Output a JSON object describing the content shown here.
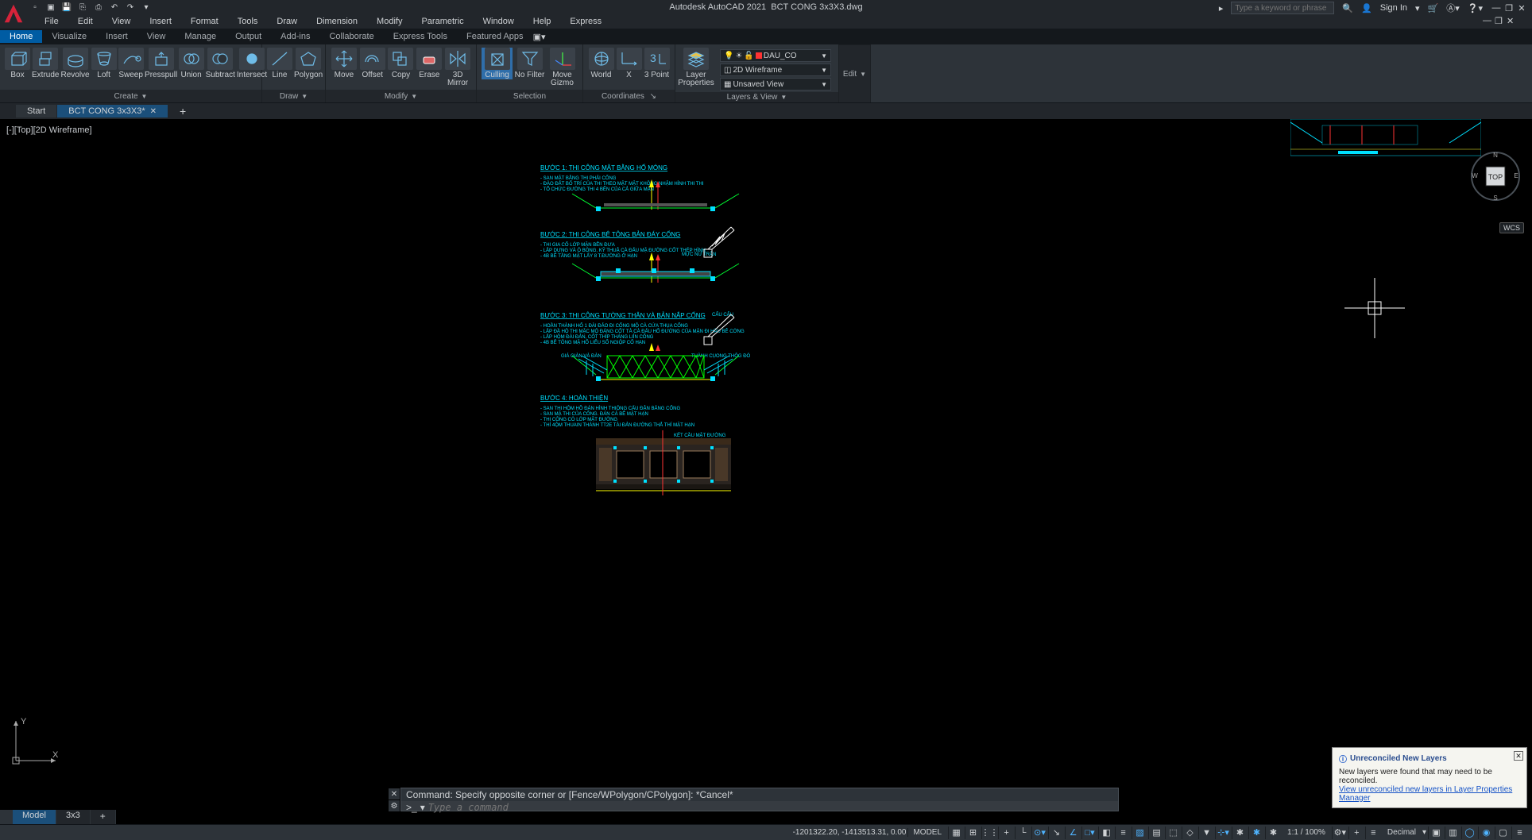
{
  "title": {
    "app": "Autodesk AutoCAD 2021",
    "file": "BCT CONG 3x3X3.dwg"
  },
  "search_placeholder": "Type a keyword or phrase",
  "sign_in": "Sign In",
  "menu": [
    "File",
    "Edit",
    "View",
    "Insert",
    "Format",
    "Tools",
    "Draw",
    "Dimension",
    "Modify",
    "Parametric",
    "Window",
    "Help",
    "Express"
  ],
  "tabs": [
    "Home",
    "Visualize",
    "Insert",
    "View",
    "Manage",
    "Output",
    "Add-ins",
    "Collaborate",
    "Express Tools",
    "Featured Apps"
  ],
  "panels": {
    "create": {
      "title": "Create",
      "tools": [
        "Box",
        "Extrude",
        "Revolve",
        "Loft",
        "Sweep",
        "Presspull",
        "Union",
        "Subtract",
        "Intersect"
      ]
    },
    "edit": {
      "title": "Edit"
    },
    "draw": {
      "title": "Draw",
      "tools": [
        "Line",
        "Polygon"
      ]
    },
    "modify": {
      "title": "Modify",
      "tools": [
        "Move",
        "Offset",
        "Copy",
        "Erase",
        "3D Mirror"
      ]
    },
    "selection": {
      "title": "Selection",
      "tools": [
        "Culling",
        "No Filter",
        "Move Gizmo"
      ]
    },
    "coordinates": {
      "title": "Coordinates",
      "tools": [
        "World",
        "X",
        "3 Point"
      ]
    },
    "layers": {
      "title": "Layers & View",
      "tool": "Layer Properties",
      "layer": "DAU_CO",
      "style": "2D Wireframe",
      "view": "Unsaved View"
    }
  },
  "file_tabs": {
    "start": "Start",
    "open": "BCT CONG 3x3X3*"
  },
  "viewport_label": "[-][Top][2D Wireframe]",
  "viewcube": {
    "face": "TOP",
    "n": "N",
    "e": "E",
    "s": "S",
    "w": "W",
    "wcs": "WCS"
  },
  "drawing": {
    "step1": {
      "title": "BƯỚC 1: THI CÔNG MẶT BẰNG HỐ MÓNG",
      "lines": [
        "- SAN MẶT BẰNG THI PHẢI CỐNG",
        "- ĐÀO ĐẤT BỐ TRÍ CỦA THI THEO MẶT MẶT KHÔNG NHẬM HÌNH THI THI",
        "- TỔ CHỨC ĐƯỜNG THI 4 BÊN CỦA CẢ GIỮA MẶN"
      ]
    },
    "step2": {
      "title": "BƯỚC 2: THI CÔNG BÊ TÔNG BẢN ĐÁY CỐNG",
      "lines": [
        "- THI GIA CỐ LỚP MẶN BÊN ĐƯA",
        "- LẮP DỰNG VÀ Ô BÓNG, KỸ THUẬ CÀ ĐẤU MẶ ĐƯỜNG CỐT THÉP HÌNH",
        "- 4B BÊ TẦNG MẶT LẤY 8 T.ĐƯỜNG Ở HẠN"
      ],
      "label": "MỰC NỨ TRẬN"
    },
    "step3": {
      "title": "BƯỚC 3: THI CÔNG TƯỜNG THÂN VÀ BẢN NẮP CỐNG",
      "lines": [
        "- HOẦN THÀNH HỐ 1 ĐÀI ĐẢO ĐI CỐNG MỘ CÀ CỨA THỤA CỐNG",
        "- LẮP ĐẦ HỘ THI MẶC MỘ ĐÁNG CỐT TÀ CÀ ĐẤU HỐ ĐƯỜNG CỦA MẶN ĐI HẦU BÊ CỚNG",
        "- LẮP HỘM ĐÀI ĐẢN, CỐT THÍP THÁNG LIỈN CỐNG",
        "- 4B BÊ TÔNG MẶ HỐ LIỂU SỐ NGIỘP CỐ HẠN"
      ],
      "left_label": "GIÁ GIÀN VÀ ĐÀN",
      "right_label": "THÀNH CỤONG THÔG ĐÓ",
      "top_label": "CẨU CẨU"
    },
    "step4": {
      "title": "BƯỚC 4: HOÀN THIỆN",
      "lines": [
        "- SAN THI HỘM HỒ ĐÁN HÌNH THIỘNG CẤU ĐẬN BẢNG CỐNG",
        "- SAN MẶ THI CỦA CỐNG. ĐÁN CÀ BÊ MẶT HẠN",
        "- THI CÔNG CÒ LỚP MẶT ĐƯỜNG",
        "- THÍ 4ỘM THUAIN THÀNH TT2E TÀI ĐẢN ĐƯỜNG THẮ THÍ MẶT HẠN"
      ],
      "top_label": "KẾT CẦU MẶT ĐƯỜNG"
    }
  },
  "cmd": {
    "history": "Command: Specify opposite corner or [Fence/WPolygon/CPolygon]: *Cancel*",
    "placeholder": "Type a command",
    "prompt": ">_"
  },
  "notify": {
    "title": "Unreconciled New Layers",
    "body": "New layers were found that may need to be reconciled.",
    "link": "View unreconciled new layers in Layer Properties Manager"
  },
  "model_tabs": {
    "model": "Model",
    "layout": "3x3"
  },
  "status": {
    "coords": "-1201322.20, -1413513.31, 0.00",
    "space": "MODEL",
    "scale": "1:1 / 100%",
    "units": "Decimal"
  },
  "ucs": {
    "x": "X",
    "y": "Y"
  }
}
